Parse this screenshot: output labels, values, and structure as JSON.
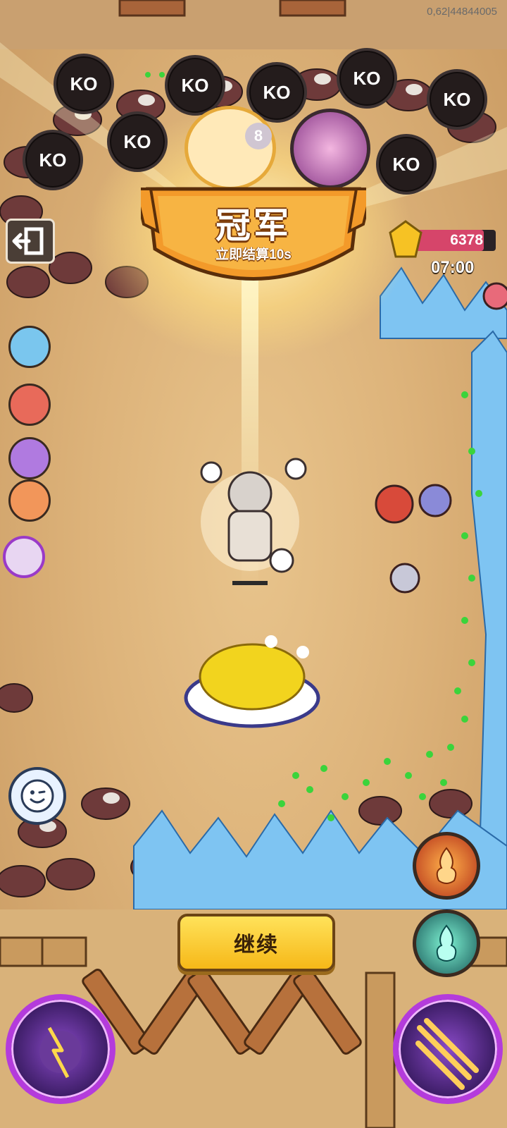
{
  "version": "0,62|44844005",
  "ko_label": "KO",
  "ko_badges": [
    "KO",
    "KO",
    "KO",
    "KO",
    "KO",
    "KO",
    "KO",
    "KO",
    "KO"
  ],
  "banner": {
    "title": "冠军",
    "subtitle": "立即结算10s"
  },
  "rank_badge": "8",
  "score": "6378",
  "timer": "07:00",
  "continue_label": "继续",
  "colors": {
    "banner_orange": "#f39a2a",
    "button_yellow": "#fcd12f",
    "score_pink": "#d6456a",
    "skill_purple": "#b43bdc"
  },
  "icons": [
    "exit-icon",
    "chat-emoji-icon",
    "fire-skill-icon",
    "wind-skill-icon",
    "ultimate-skill-icon",
    "sword-skill-icon",
    "gem-icon"
  ]
}
